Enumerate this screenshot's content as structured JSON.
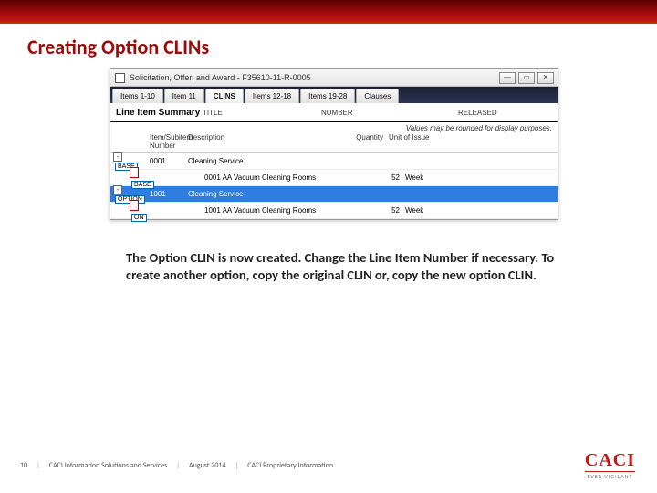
{
  "slide": {
    "title": "Creating Option CLINs",
    "body": "The Option CLIN is now created.  Change the Line Item Number if necessary.  To create another option, copy the original CLIN or, copy the new option CLIN."
  },
  "window": {
    "caption": "Solicitation, Offer, and Award - F35610-11-R-0005"
  },
  "tabs": [
    {
      "label": "Items 1-10"
    },
    {
      "label": "Item 11"
    },
    {
      "label": "CLINS",
      "active": true
    },
    {
      "label": "Items 12-18"
    },
    {
      "label": "Items 19-28"
    },
    {
      "label": "Clauses"
    }
  ],
  "header": {
    "summary_label": "Line Item Summary",
    "title_label": "TITLE",
    "number_label": "NUMBER",
    "released_label": "RELEASED",
    "rounding_note": "Values may be rounded for display purposes.",
    "sub": {
      "num": "Item/Subitem Number",
      "desc": "Description",
      "qty": "Quantity",
      "uoi": "Unit of Issue"
    }
  },
  "rows": [
    {
      "badge": "BASE",
      "num": "0001",
      "desc": "Cleaning Service",
      "qty": "",
      "uoi": "",
      "kind": "parent"
    },
    {
      "badge": "BASE",
      "num": "",
      "desc": "0001 AA Vacuum Cleaning Rooms",
      "qty": "52",
      "uoi": "Week",
      "kind": "child"
    },
    {
      "badge": "OPTION",
      "num": "1001",
      "desc": "Cleaning Service",
      "qty": "",
      "uoi": "",
      "kind": "parent",
      "selected": true
    },
    {
      "badge": "ON",
      "num": "",
      "desc": "1001 AA Vacuum Cleaning Rooms",
      "qty": "52",
      "uoi": "Week",
      "kind": "child"
    }
  ],
  "footer": {
    "page": "10",
    "org": "CACI Information Solutions and Services",
    "date": "August 2014",
    "class": "CACI Proprietary Information",
    "logo": "CACI",
    "tagline": "EVER VIGILANT"
  }
}
